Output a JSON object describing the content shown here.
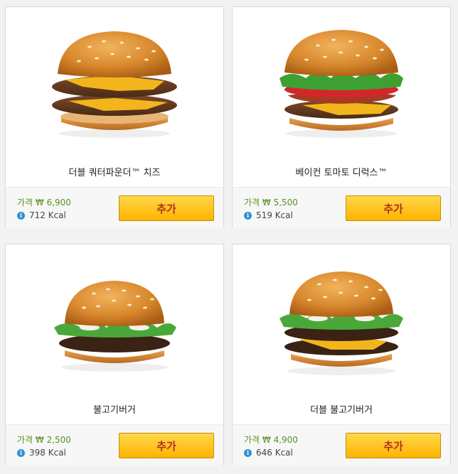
{
  "products": [
    {
      "name": "더블 쿼터파운더™ 치즈",
      "price": "가격 ₩ 6,900",
      "kcal": "712 Kcal",
      "add_label": "추가",
      "image": "double-quarter-pounder-cheese-burger"
    },
    {
      "name": "베이컨 토마토 디럭스™",
      "price": "가격 ₩ 5,500",
      "kcal": "519 Kcal",
      "add_label": "추가",
      "image": "bacon-tomato-deluxe-burger"
    },
    {
      "name": "불고기버거",
      "price": "가격 ₩ 2,500",
      "kcal": "398 Kcal",
      "add_label": "추가",
      "image": "bulgogi-burger"
    },
    {
      "name": "더블 불고기버거",
      "price": "가격 ₩ 4,900",
      "kcal": "646 Kcal",
      "add_label": "추가",
      "image": "double-bulgogi-burger"
    }
  ],
  "icons": {
    "info": "info-icon"
  },
  "colors": {
    "price": "#5a8f1f",
    "button_top": "#ffd84a",
    "button_bottom": "#ffb300",
    "button_text": "#b0321b",
    "info": "#2f8fd8"
  }
}
